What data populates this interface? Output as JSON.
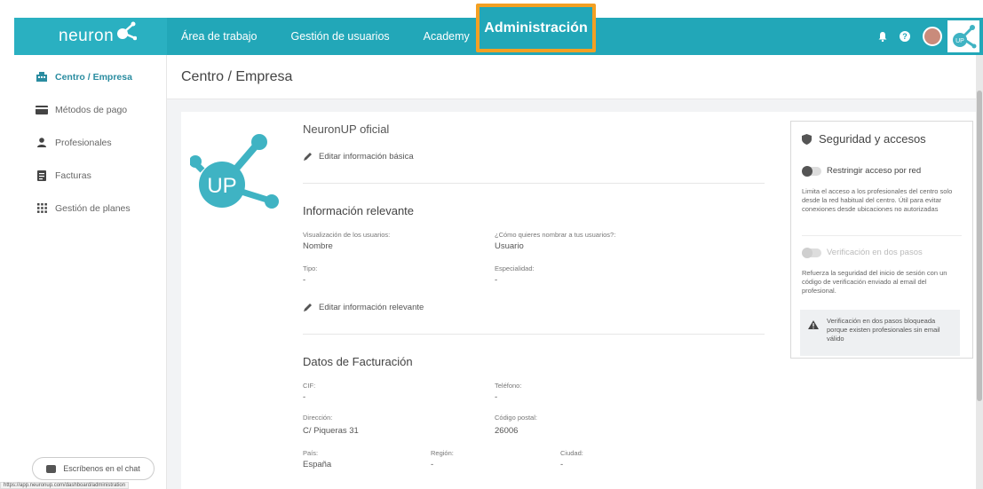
{
  "brand": {
    "logo_text": "neuron"
  },
  "nav": {
    "items": [
      "Área de trabajo",
      "Gestión de usuarios",
      "Academy"
    ],
    "admin_label": "Administración"
  },
  "header_icons": [
    "bell-icon",
    "help-icon",
    "avatar",
    "up-logo"
  ],
  "sidebar": {
    "items": [
      {
        "label": "Centro / Empresa",
        "icon": "building-icon",
        "active": true
      },
      {
        "label": "Métodos de pago",
        "icon": "credit-card-icon",
        "active": false
      },
      {
        "label": "Profesionales",
        "icon": "person-icon",
        "active": false
      },
      {
        "label": "Facturas",
        "icon": "document-icon",
        "active": false
      },
      {
        "label": "Gestión de planes",
        "icon": "grid-icon",
        "active": false
      }
    ],
    "chat_label": "Escríbenos en el chat",
    "status_url": "https://app.neuronup.com/dashboard/administration"
  },
  "page": {
    "title": "Centro / Empresa"
  },
  "center": {
    "name": "NeuronUP oficial",
    "edit_basic": "Editar información básica",
    "relevant": {
      "title": "Información relevante",
      "fields": [
        {
          "label": "Visualización de los usuarios:",
          "value": "Nombre"
        },
        {
          "label": "¿Cómo quieres nombrar a tus usuarios?:",
          "value": "Usuario"
        },
        {
          "label": "Tipo:",
          "value": "-"
        },
        {
          "label": "Especialidad:",
          "value": "-"
        }
      ],
      "edit_label": "Editar información relevante"
    },
    "billing": {
      "title": "Datos de Facturación",
      "fields": [
        {
          "label": "CIF:",
          "value": "-"
        },
        {
          "label": "Teléfono:",
          "value": "-"
        },
        {
          "label": "Dirección:",
          "value": "C/ Piqueras 31"
        },
        {
          "label": "Código postal:",
          "value": "26006"
        },
        {
          "label": "País:",
          "value": "España"
        },
        {
          "label": "Región:",
          "value": "-"
        },
        {
          "label": "Ciudad:",
          "value": "-"
        }
      ]
    }
  },
  "security": {
    "title": "Seguridad y accesos",
    "restrict_label": "Restringir acceso por red",
    "restrict_desc": "Limita el acceso a los profesionales del centro solo desde la red habitual del centro. Útil para evitar conexiones desde ubicaciones no autorizadas",
    "twofa_label": "Verificación en dos pasos",
    "twofa_desc": "Refuerza la seguridad del inicio de sesión con un código de verificación enviado al email del profesional.",
    "warning": "Verificación en dos pasos bloqueada porque existen profesionales sin email válido"
  },
  "colors": {
    "primary": "#22a7b8",
    "highlight": "#f3a023",
    "active_text": "#2a8ca0"
  }
}
